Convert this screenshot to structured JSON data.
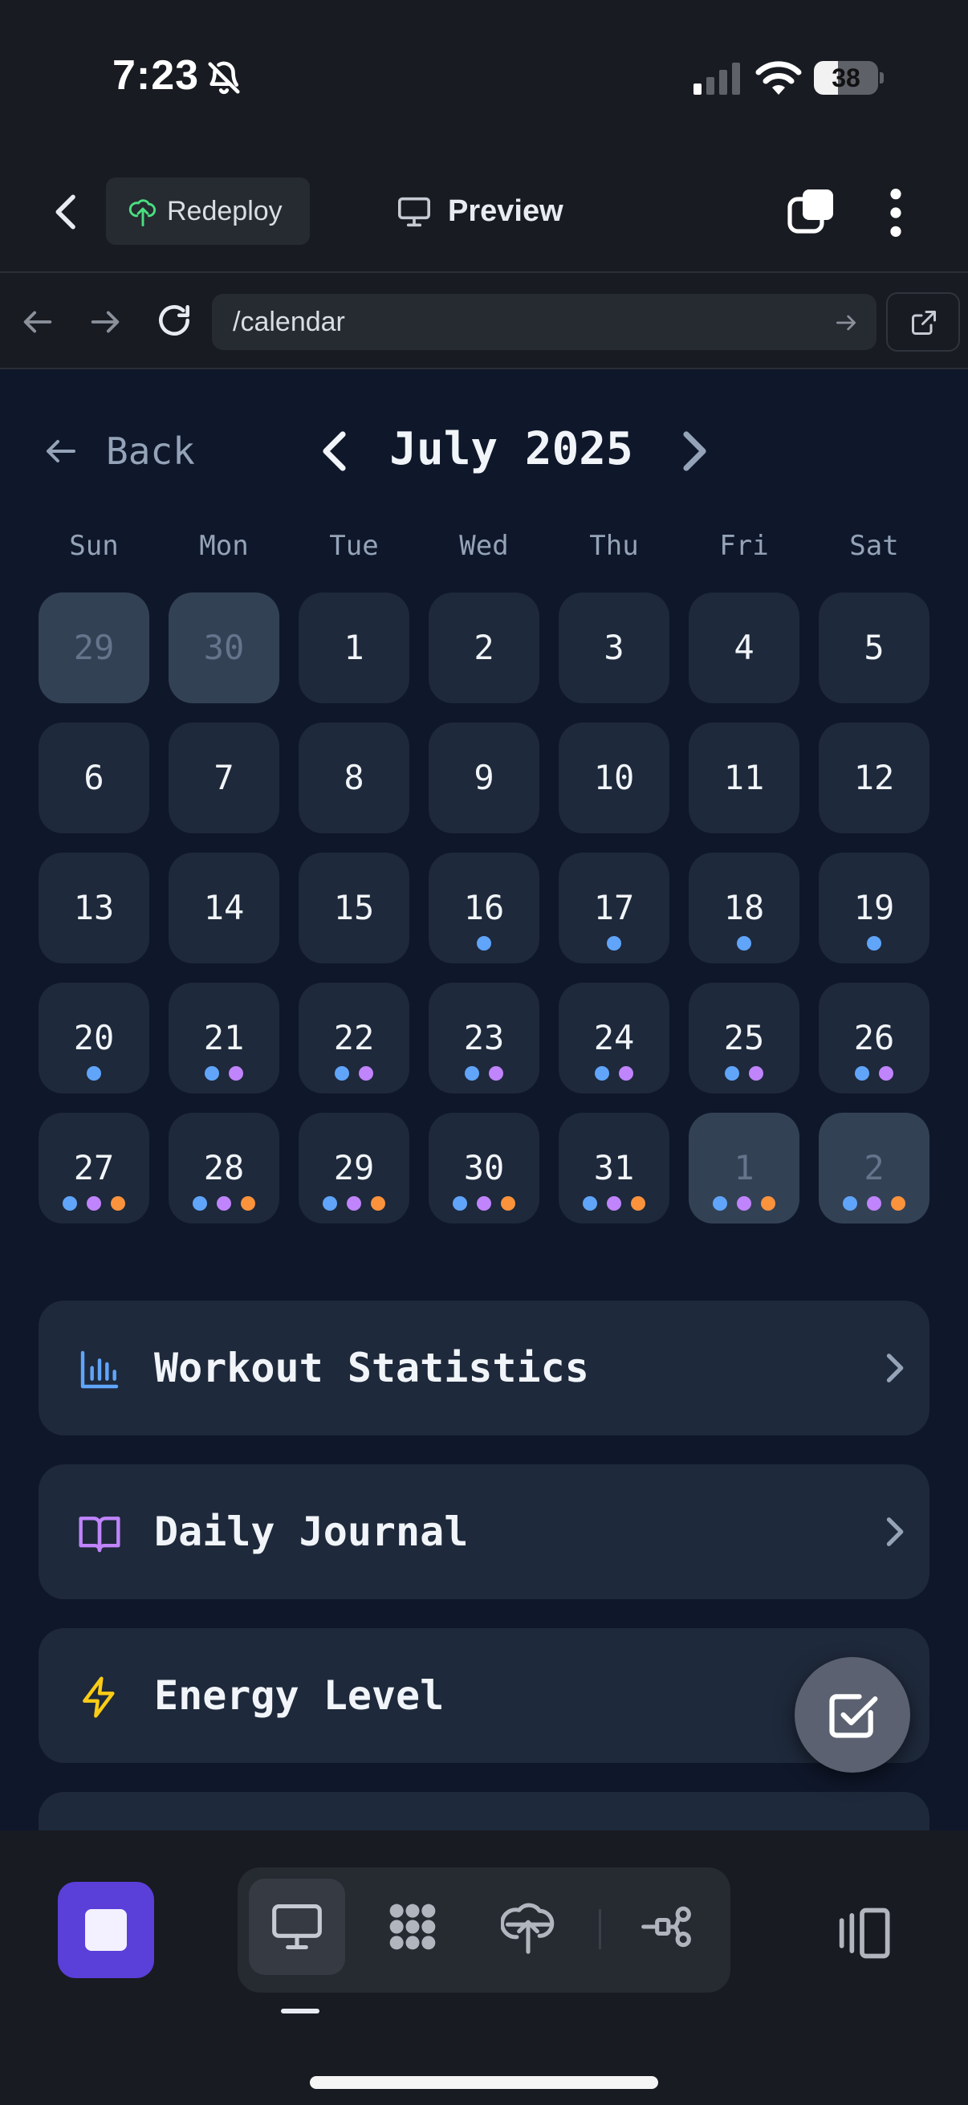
{
  "status_bar": {
    "time": "7:23",
    "battery_percent": 38,
    "battery_label": "38"
  },
  "app_header": {
    "redeploy_label": "Redeploy",
    "preview_label": "Preview"
  },
  "browser": {
    "url": "/calendar"
  },
  "calendar": {
    "back_label": "Back",
    "month_title": "July 2025",
    "weekdays": [
      "Sun",
      "Mon",
      "Tue",
      "Wed",
      "Thu",
      "Fri",
      "Sat"
    ],
    "dot_colors": {
      "blue": "#60a5fa",
      "purple": "#c084fc",
      "orange": "#fb923c"
    },
    "weeks": [
      [
        {
          "n": "29",
          "muted": true,
          "dots": []
        },
        {
          "n": "30",
          "muted": true,
          "dots": []
        },
        {
          "n": "1",
          "muted": false,
          "dots": []
        },
        {
          "n": "2",
          "muted": false,
          "dots": []
        },
        {
          "n": "3",
          "muted": false,
          "dots": []
        },
        {
          "n": "4",
          "muted": false,
          "dots": []
        },
        {
          "n": "5",
          "muted": false,
          "dots": []
        }
      ],
      [
        {
          "n": "6",
          "muted": false,
          "dots": []
        },
        {
          "n": "7",
          "muted": false,
          "dots": []
        },
        {
          "n": "8",
          "muted": false,
          "dots": []
        },
        {
          "n": "9",
          "muted": false,
          "dots": []
        },
        {
          "n": "10",
          "muted": false,
          "dots": []
        },
        {
          "n": "11",
          "muted": false,
          "dots": []
        },
        {
          "n": "12",
          "muted": false,
          "dots": []
        }
      ],
      [
        {
          "n": "13",
          "muted": false,
          "dots": []
        },
        {
          "n": "14",
          "muted": false,
          "dots": []
        },
        {
          "n": "15",
          "muted": false,
          "dots": []
        },
        {
          "n": "16",
          "muted": false,
          "dots": [
            "blue"
          ]
        },
        {
          "n": "17",
          "muted": false,
          "dots": [
            "blue"
          ]
        },
        {
          "n": "18",
          "muted": false,
          "dots": [
            "blue"
          ]
        },
        {
          "n": "19",
          "muted": false,
          "dots": [
            "blue"
          ]
        }
      ],
      [
        {
          "n": "20",
          "muted": false,
          "dots": [
            "blue"
          ]
        },
        {
          "n": "21",
          "muted": false,
          "dots": [
            "blue",
            "purple"
          ]
        },
        {
          "n": "22",
          "muted": false,
          "dots": [
            "blue",
            "purple"
          ]
        },
        {
          "n": "23",
          "muted": false,
          "dots": [
            "blue",
            "purple"
          ]
        },
        {
          "n": "24",
          "muted": false,
          "dots": [
            "blue",
            "purple"
          ]
        },
        {
          "n": "25",
          "muted": false,
          "dots": [
            "blue",
            "purple"
          ]
        },
        {
          "n": "26",
          "muted": false,
          "dots": [
            "blue",
            "purple"
          ]
        }
      ],
      [
        {
          "n": "27",
          "muted": false,
          "dots": [
            "blue",
            "purple",
            "orange"
          ]
        },
        {
          "n": "28",
          "muted": false,
          "dots": [
            "blue",
            "purple",
            "orange"
          ]
        },
        {
          "n": "29",
          "muted": false,
          "dots": [
            "blue",
            "purple",
            "orange"
          ]
        },
        {
          "n": "30",
          "muted": false,
          "dots": [
            "blue",
            "purple",
            "orange"
          ]
        },
        {
          "n": "31",
          "muted": false,
          "dots": [
            "blue",
            "purple",
            "orange"
          ]
        },
        {
          "n": "1",
          "muted": true,
          "dots": [
            "blue",
            "purple",
            "orange"
          ]
        },
        {
          "n": "2",
          "muted": true,
          "dots": [
            "blue",
            "purple",
            "orange"
          ]
        }
      ]
    ]
  },
  "cards": [
    {
      "label": "Workout Statistics",
      "icon": "bar-chart-icon",
      "color": "#60a5fa"
    },
    {
      "label": "Daily Journal",
      "icon": "book-open-icon",
      "color": "#c084fc"
    },
    {
      "label": "Energy Level",
      "icon": "lightning-icon",
      "color": "#facc15"
    }
  ],
  "toolbar": {
    "accent_color": "#5b3fd9",
    "active_tab": "preview"
  }
}
